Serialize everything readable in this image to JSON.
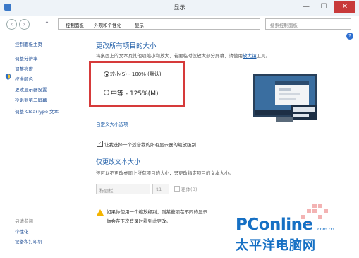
{
  "window": {
    "title": "显示"
  },
  "titlebar_buttons": {
    "minimize": "—",
    "maximize": "☐",
    "close": "✕"
  },
  "nav": {
    "back": "‹",
    "forward": "›",
    "up": "↑"
  },
  "breadcrumb": [
    "控制面板",
    "外观和个性化",
    "显示"
  ],
  "search": {
    "placeholder": "搜索控制面板"
  },
  "sidebar": {
    "items": [
      "控制面板主页",
      "调整分辨率",
      "调整亮度",
      "校准颜色",
      "更改显示器设置",
      "投影到第二屏幕",
      "调整 ClearType 文本"
    ],
    "see_also": "另请参阅",
    "see_also_items": [
      "个性化",
      "设备和打印机"
    ]
  },
  "main": {
    "heading": "更改所有项目的大小",
    "description": "将桌面上的文本及其他项缩小和放大，若要临时仅放大部分屏幕，请使用",
    "magnifier_link": "放大镜",
    "description_tail": "工具。",
    "options": [
      {
        "label": "较小(S) - 100% (默认)",
        "selected": true
      },
      {
        "label": "中等 - 125%(M)",
        "selected": false
      }
    ],
    "custom_link": "自定义大小选项",
    "checkbox_label": "让我选择一个适合我的所有显示器的缩放级别",
    "checkbox_checked": true,
    "heading2": "仅更改文本大小",
    "description2": "还可以不更改桌面上所有项目的大小，只更改指定项目的文本大小。",
    "item_select": "标题栏",
    "size_select": "11",
    "bold_label": "粗体(B)",
    "warning_line1": "如果你使用一个缩放级别，则某些项在不同的显示",
    "warning_line2": "你会在下次登录时看到此更改。"
  },
  "watermark": {
    "brand": "PConline",
    "domain": ".com.cn",
    "chinese": "太平洋电脑网"
  },
  "help": "?",
  "colors": {
    "accent": "#1f5ea8",
    "highlight_box": "#d63a3a",
    "brand": "#1670c4"
  }
}
